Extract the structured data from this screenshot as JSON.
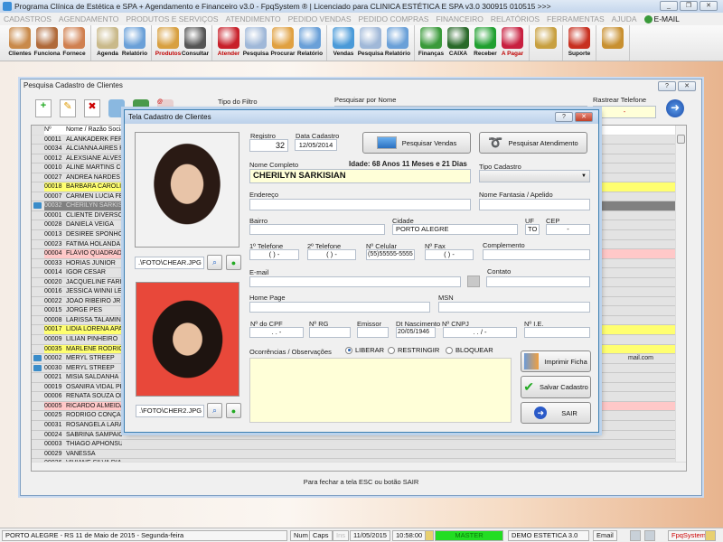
{
  "window_title": "Programa Clínica de Estética e SPA + Agendamento e Financeiro v3.0 - FpqSystem ® | Licenciado para  CLINICA ESTÉTICA E SPA v3.0 300915 010515 >>>",
  "menu": [
    "CADASTROS",
    "AGENDAMENTO",
    "PRODUTOS E SERVIÇOS",
    "ATENDIMENTO",
    "PEDIDO VENDAS",
    "PEDIDO COMPRAS",
    "FINANCEIRO",
    "RELATÓRIOS",
    "FERRAMENTAS",
    "AJUDA"
  ],
  "menu_email": "E-MAIL",
  "toolbar_groups": [
    [
      {
        "label": "Clientes",
        "color": "#c98a4a"
      },
      {
        "label": "Funciona",
        "color": "#b06a3a"
      },
      {
        "label": "Fornece",
        "color": "#d08050"
      }
    ],
    [
      {
        "label": "Agenda",
        "color": "#c9b98a"
      },
      {
        "label": "Relatório",
        "color": "#6aa0d8"
      }
    ],
    [
      {
        "label": "Produtos",
        "color": "#d8a040",
        "labelColor": "#c00000"
      },
      {
        "label": "Consultar",
        "color": "#555555"
      }
    ],
    [
      {
        "label": "Atender",
        "color": "#c8202a",
        "labelColor": "#c00000"
      },
      {
        "label": "Pesquisa",
        "color": "#a0b8d8"
      },
      {
        "label": "Procurar",
        "color": "#e0a040"
      },
      {
        "label": "Relatório",
        "color": "#6aa0d8"
      }
    ],
    [
      {
        "label": "Vendas",
        "color": "#4a9ad8"
      },
      {
        "label": "Pesquisa",
        "color": "#a0b8d8"
      },
      {
        "label": "Relatório",
        "color": "#6aa0d8"
      }
    ],
    [
      {
        "label": "Finanças",
        "color": "#3a9a3a"
      },
      {
        "label": "CAIXA",
        "color": "#2a6a2a"
      },
      {
        "label": "Receber",
        "color": "#20a030"
      },
      {
        "label": "A Pagar",
        "color": "#c82040",
        "labelColor": "#c00000"
      }
    ],
    [
      {
        "label": "",
        "color": "#c8a040"
      }
    ],
    [
      {
        "label": "Suporte",
        "color": "#c83020"
      }
    ],
    [
      {
        "label": "",
        "color": "#c89030"
      }
    ]
  ],
  "search_window": {
    "title": "Pesquisa Cadastro de Clientes",
    "filter_label": "Tipo do Filtro",
    "search_label": "Pesquisar por Nome",
    "search_value": "",
    "phone_label": "Rastrear Telefone",
    "phone_value": "-",
    "footer_hint": "Para fechar a tela ESC ou botão SAIR",
    "columns": [
      "Nº",
      "Nome / Razão Social"
    ],
    "rows": [
      {
        "n": "00011",
        "name": "ALANKADERK FERR",
        "s": ""
      },
      {
        "n": "00034",
        "name": "ALCIANNA AIRES RO",
        "s": ""
      },
      {
        "n": "00012",
        "name": "ALEXSIANE ALVES",
        "s": ""
      },
      {
        "n": "00010",
        "name": "ALINE MARTINS COI",
        "s": ""
      },
      {
        "n": "00027",
        "name": "ANDREA NARDES",
        "s": ""
      },
      {
        "n": "00018",
        "name": "BARBARA CAROLINI",
        "s": "yellow"
      },
      {
        "n": "00007",
        "name": "CARMEN LUCIA FER",
        "s": ""
      },
      {
        "n": "00032",
        "name": "CHERILYN SARKISIA",
        "s": "sel",
        "icon": true
      },
      {
        "n": "00001",
        "name": "CLIENTE DIVERSOS",
        "s": ""
      },
      {
        "n": "00028",
        "name": "DANIELA VEIGA",
        "s": ""
      },
      {
        "n": "00013",
        "name": "DESIREE SPONHOLZ",
        "s": ""
      },
      {
        "n": "00023",
        "name": "FATIMA HOLANDA",
        "s": ""
      },
      {
        "n": "00004",
        "name": "FLÁVIO QUADRADO",
        "s": "pink"
      },
      {
        "n": "00033",
        "name": "HORIAS JUNIOR",
        "s": ""
      },
      {
        "n": "00014",
        "name": "IGOR CESAR",
        "s": ""
      },
      {
        "n": "00020",
        "name": "JACQUELINE FARIA",
        "s": ""
      },
      {
        "n": "00016",
        "name": "JESSICA WINNI LEIT",
        "s": ""
      },
      {
        "n": "00022",
        "name": "JOAO RIBEIRO JR",
        "s": ""
      },
      {
        "n": "00015",
        "name": "JORGE PES",
        "s": ""
      },
      {
        "n": "00008",
        "name": "LARISSA TALAMINI",
        "s": ""
      },
      {
        "n": "00017",
        "name": "LIDIA LORENA APAR",
        "s": "yellow"
      },
      {
        "n": "00009",
        "name": "LILIAN PINHEIRO",
        "s": ""
      },
      {
        "n": "00035",
        "name": "MARLENE RODRIGU",
        "s": "yellow"
      },
      {
        "n": "00002",
        "name": "MERYL STREEP",
        "s": "",
        "icon": true,
        "extra": "mail.com"
      },
      {
        "n": "00030",
        "name": "MERYL STREEP",
        "s": "",
        "icon": true
      },
      {
        "n": "00021",
        "name": "MISIA SALDANHA",
        "s": ""
      },
      {
        "n": "00019",
        "name": "OSANIRA VIDAL PER",
        "s": ""
      },
      {
        "n": "00006",
        "name": "RENATA SOUZA OLI",
        "s": ""
      },
      {
        "n": "00005",
        "name": "RICARDO ALMEIDA",
        "s": "pink"
      },
      {
        "n": "00025",
        "name": "RODRIGO CONÇALV",
        "s": ""
      },
      {
        "n": "00031",
        "name": "ROSANGELA LARA",
        "s": ""
      },
      {
        "n": "00024",
        "name": "SABRINA SAMPAIO",
        "s": ""
      },
      {
        "n": "00003",
        "name": "THIAGO APHONSUS",
        "s": ""
      },
      {
        "n": "00029",
        "name": "VANESSA",
        "s": ""
      },
      {
        "n": "00026",
        "name": "VIVIANE SILVA DIAS",
        "s": ""
      }
    ]
  },
  "modal": {
    "title": "Tela Cadastro de Clientes",
    "registro_label": "Registro",
    "registro": "32",
    "data_cadastro_label": "Data Cadastro",
    "data_cadastro": "12/05/2014",
    "pesquisar_vendas": "Pesquisar Vendas",
    "pesquisar_atendimento": "Pesquisar Atendimento",
    "nome_label": "Nome Completo",
    "nome": "CHERILYN SARKISIAN",
    "idade": "Idade: 68 Anos 11 Meses e 21 Dias",
    "tipo_label": "Tipo Cadastro",
    "tipo": "",
    "endereco_label": "Endereço",
    "endereco": "",
    "fantasia_label": "Nome Fantasia / Apelido",
    "fantasia": "",
    "bairro_label": "Bairro",
    "bairro": "",
    "cidade_label": "Cidade",
    "cidade": "PORTO ALEGRE",
    "uf_label": "UF",
    "uf": "TO",
    "cep_label": "CEP",
    "cep": "-",
    "tel1_label": "1º Telefone",
    "tel1": "(  )    -",
    "tel2_label": "2º Telefone",
    "tel2": "(  )    -",
    "cel_label": "Nº Celular",
    "cel": "(55)55555-5555",
    "fax_label": "Nº Fax",
    "fax": "(  )    -",
    "complemento_label": "Complemento",
    "complemento": "",
    "email_label": "E-mail",
    "email": "",
    "contato_label": "Contato",
    "contato": "",
    "homepage_label": "Home Page",
    "homepage": "",
    "msn_label": "MSN",
    "msn": "",
    "cpf_label": "Nº do CPF",
    "cpf": ".   .   -",
    "rg_label": "Nº RG",
    "rg": "",
    "emissor_label": "Emissor",
    "emissor": "",
    "nasc_label": "Dt Nascimento",
    "nasc": "20/05/1946",
    "cnpj_label": "Nº CNPJ",
    "cnpj": ".   .   /   -",
    "ie_label": "Nº I.E.",
    "ie": "",
    "obs_label": "Ocorrências / Observações",
    "obs": "",
    "radio_liberar": "LIBERAR",
    "radio_restringir": "RESTRINGIR",
    "radio_bloquear": "BLOQUEAR",
    "imprimir": "Imprimir Ficha",
    "salvar": "Salvar Cadastro",
    "sair": "SAIR",
    "foto1": ".\\FOTO\\CHEAR.JPG",
    "foto2": ".\\FOTO\\CHER2.JPG"
  },
  "status": {
    "location": "PORTO ALEGRE - RS 11 de Maio de 2015 - Segunda-feira",
    "num": "Num",
    "caps": "Caps",
    "ins": "Ins",
    "date": "11/05/2015",
    "time": "10:58:00",
    "user": "MASTER",
    "db": "DEMO ESTETICA 3.0",
    "email": "Email",
    "brand": "FpqSystem",
    "user_color": "#22dd22"
  }
}
